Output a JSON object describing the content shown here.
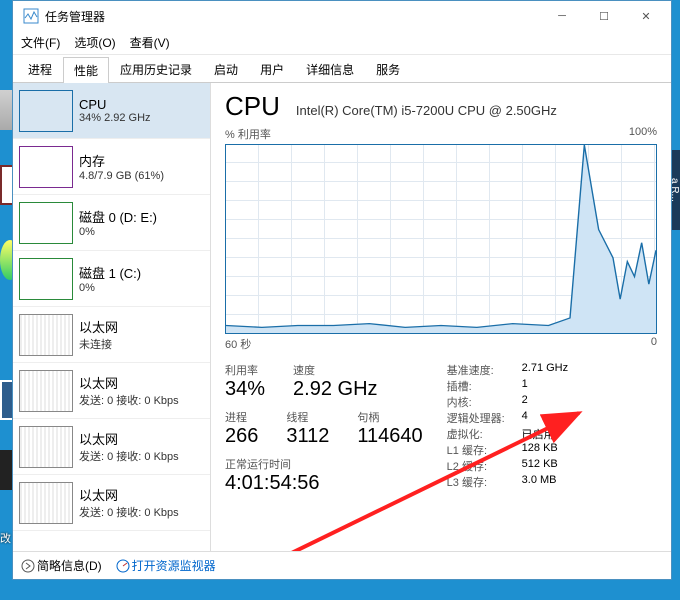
{
  "window": {
    "title": "任务管理器"
  },
  "menu": {
    "file": "文件(F)",
    "options": "选项(O)",
    "view": "查看(V)"
  },
  "tabs": [
    "进程",
    "性能",
    "应用历史记录",
    "启动",
    "用户",
    "详细信息",
    "服务"
  ],
  "active_tab": 1,
  "sidebar": [
    {
      "name": "CPU",
      "sub": "34% 2.92 GHz",
      "type": "cpu",
      "selected": true
    },
    {
      "name": "内存",
      "sub": "4.8/7.9 GB (61%)",
      "type": "mem"
    },
    {
      "name": "磁盘 0 (D: E:)",
      "sub": "0%",
      "type": "disk"
    },
    {
      "name": "磁盘 1 (C:)",
      "sub": "0%",
      "type": "disk"
    },
    {
      "name": "以太网",
      "sub": "未连接",
      "type": "eth"
    },
    {
      "name": "以太网",
      "sub": "发送: 0 接收: 0 Kbps",
      "type": "eth"
    },
    {
      "name": "以太网",
      "sub": "发送: 0 接收: 0 Kbps",
      "type": "eth"
    },
    {
      "name": "以太网",
      "sub": "发送: 0 接收: 0 Kbps",
      "type": "eth"
    }
  ],
  "main": {
    "title": "CPU",
    "model": "Intel(R) Core(TM) i5-7200U CPU @ 2.50GHz",
    "chart_top_left": "% 利用率",
    "chart_top_right": "100%",
    "chart_bot_left": "60 秒",
    "chart_bot_right": "0",
    "row1_labels": {
      "util": "利用率",
      "speed": "速度"
    },
    "util": "34%",
    "speed": "2.92 GHz",
    "row2_labels": {
      "proc": "进程",
      "thr": "线程",
      "hnd": "句柄"
    },
    "processes": "266",
    "threads": "3112",
    "handles": "114640",
    "uptime_label": "正常运行时间",
    "uptime": "4:01:54:56",
    "right": [
      {
        "k": "基准速度:",
        "v": "2.71 GHz"
      },
      {
        "k": "插槽:",
        "v": "1"
      },
      {
        "k": "内核:",
        "v": "2"
      },
      {
        "k": "逻辑处理器:",
        "v": "4"
      },
      {
        "k": "虚拟化:",
        "v": "已启用"
      },
      {
        "k": "L1 缓存:",
        "v": "128 KB"
      },
      {
        "k": "L2 缓存:",
        "v": "512 KB"
      },
      {
        "k": "L3 缓存:",
        "v": "3.0 MB"
      }
    ]
  },
  "statusbar": {
    "fewer": "简略信息(D)",
    "resmon": "打开资源监视器"
  },
  "chart_data": {
    "type": "line",
    "title": "% 利用率",
    "xlabel": "60 秒",
    "ylabel": "% 利用率",
    "ylim": [
      0,
      100
    ],
    "xlim_seconds": [
      60,
      0
    ],
    "series": [
      {
        "name": "CPU utilization %",
        "x_seconds_ago": [
          60,
          55,
          50,
          45,
          40,
          35,
          30,
          25,
          20,
          15,
          12,
          10,
          8,
          6,
          5,
          4,
          3,
          2,
          1,
          0
        ],
        "values": [
          4,
          3,
          4,
          4,
          5,
          3,
          4,
          3,
          5,
          4,
          8,
          100,
          55,
          40,
          18,
          38,
          30,
          48,
          26,
          44
        ]
      }
    ]
  }
}
